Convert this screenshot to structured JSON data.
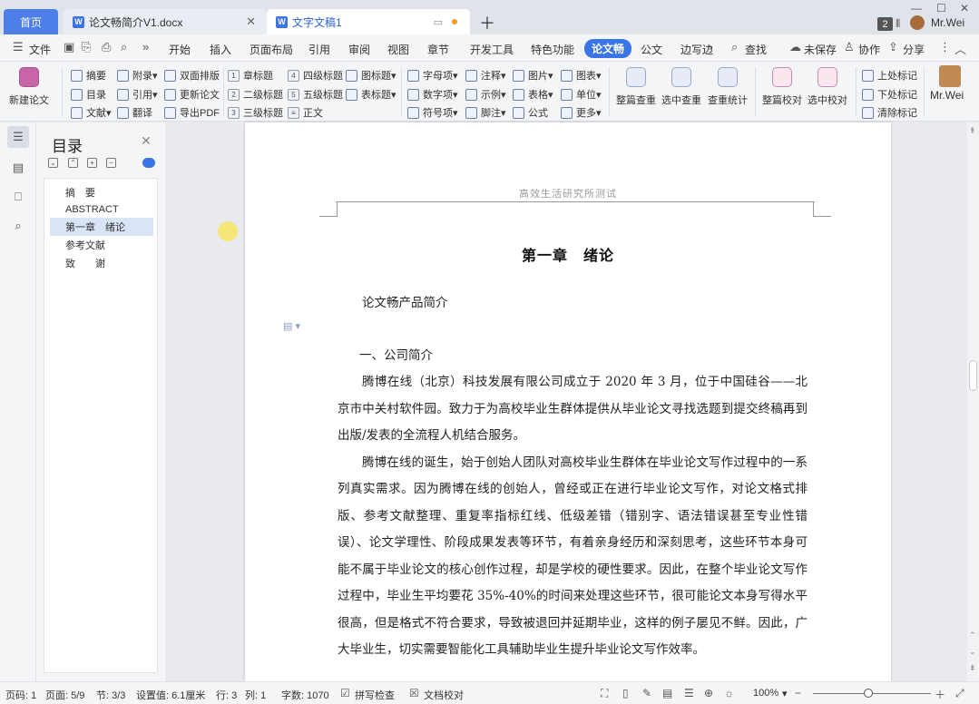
{
  "tabs": {
    "home": "首页",
    "doc1": "论文畅简介V1.docx",
    "doc2": "文字文稿1",
    "window_count": "2",
    "user": "Mr.Wei"
  },
  "menu": {
    "file": "文件",
    "items": [
      "开始",
      "插入",
      "页面布局",
      "引用",
      "审阅",
      "视图",
      "章节",
      "开发工具",
      "特色功能",
      "论文畅",
      "公文",
      "边写边"
    ],
    "search": "查找",
    "unsaved": "未保存",
    "collab": "协作",
    "share": "分享"
  },
  "ribbon": {
    "new_paper": "新建论文",
    "abstract": "摘要",
    "appendix": "附录",
    "dual_layout": "双面排版",
    "catalog": "目录",
    "cite": "引用",
    "update_paper": "更新论文",
    "literature": "文献",
    "translate": "翻译",
    "export_pdf": "导出PDF",
    "chapter_title": "章标题",
    "h2": "二级标题",
    "h3": "三级标题",
    "h4": "四级标题",
    "h5": "五级标题",
    "body": "正文",
    "fig_title": "图标题",
    "table_title": "表标题",
    "letter_item": "字母项",
    "number_item": "数字项",
    "symbol_item": "符号项",
    "note": "注释",
    "example": "示例",
    "footnote": "脚注",
    "picture": "图片",
    "table": "表格",
    "formula": "公式",
    "chart_table": "图表",
    "unit": "单位",
    "more": "更多",
    "full_check": "整篇查重",
    "select_check": "选中查重",
    "check_stats": "查重统计",
    "full_proof": "整篇校对",
    "select_proof": "选中校对",
    "prev_mark": "上处标记",
    "next_mark": "下处标记",
    "clear_mark": "清除标记",
    "user": "Mr.Wei"
  },
  "toc": {
    "title": "目录",
    "items": [
      "摘　要",
      "ABSTRACT",
      "第一章　绪论",
      "参考文献",
      "致　　谢"
    ],
    "selected_index": 2
  },
  "doc": {
    "header": "高效生活研究所测试",
    "chapter": "第一章　绪论",
    "subtitle": "论文畅产品简介",
    "section": "一、公司简介",
    "p1": "腾博在线（北京）科技发展有限公司成立于 2020 年 3 月，位于中国硅谷——北京市中关村软件园。致力于为高校毕业生群体提供从毕业论文寻找选题到提交终稿再到出版/发表的全流程人机结合服务。",
    "p2": "腾博在线的诞生，始于创始人团队对高校毕业生群体在毕业论文写作过程中的一系列真实需求。因为腾博在线的创始人，曾经或正在进行毕业论文写作，对论文格式排版、参考文献整理、重复率指标红线、低级差错（错别字、语法错误甚至专业性错误）、论文学理性、阶段成果发表等环节，有着亲身经历和深刻思考，这些环节本身可能不属于毕业论文的核心创作过程，却是学校的硬性要求。因此，在整个毕业论文写作过程中，毕业生平均要花 35%-40%的时间来处理这些环节，很可能论文本身写得水平很高，但是格式不符合要求，导致被退回并延期毕业，这样的例子屡见不鲜。因此，广大毕业生，切实需要智能化工具辅助毕业生提升毕业论文写作效率。"
  },
  "status": {
    "page_code": "页码: 1",
    "page": "页面: 5/9",
    "section": "节: 3/3",
    "setting": "设置值: 6.1厘米",
    "row": "行: 3",
    "col": "列: 1",
    "words": "字数: 1070",
    "spell": "拼写检查",
    "proof": "文档校对",
    "zoom": "100%"
  }
}
